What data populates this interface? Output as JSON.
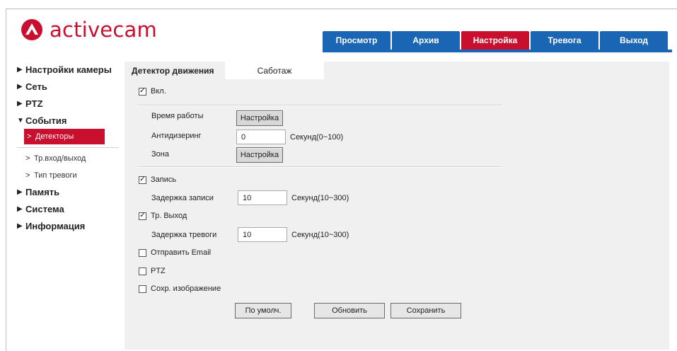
{
  "brand": {
    "name": "activecam",
    "color": "#c8102e"
  },
  "nav": {
    "tabs": [
      {
        "label": "Просмотр",
        "active": false
      },
      {
        "label": "Архив",
        "active": false
      },
      {
        "label": "Настройка",
        "active": true
      },
      {
        "label": "Тревога",
        "active": false
      },
      {
        "label": "Выход",
        "active": false
      }
    ],
    "color": "#1a66b4",
    "active_color": "#c8102e"
  },
  "sidebar": {
    "items": [
      {
        "label": "Настройки камеры"
      },
      {
        "label": "Сеть"
      },
      {
        "label": "PTZ"
      },
      {
        "label": "События",
        "expanded": true,
        "children": [
          {
            "label": "Детекторы",
            "active": true
          },
          {
            "label": "Тр.вход/выход"
          },
          {
            "label": "Тип тревоги"
          }
        ]
      },
      {
        "label": "Память"
      },
      {
        "label": "Система"
      },
      {
        "label": "Информация"
      }
    ]
  },
  "subtabs": [
    {
      "label": "Детектор движения",
      "active": true
    },
    {
      "label": "Саботаж",
      "active": false
    }
  ],
  "form": {
    "enable": {
      "label": "Вкл.",
      "checked": true
    },
    "schedule": {
      "label": "Время работы",
      "button": "Настройка"
    },
    "antidither": {
      "label": "Антидизеринг",
      "value": "0",
      "unit": "Секунд(0~100)"
    },
    "zone": {
      "label": "Зона",
      "button": "Настройка"
    },
    "record": {
      "label": "Запись",
      "checked": true
    },
    "record_delay": {
      "label": "Задержка записи",
      "value": "10",
      "unit": "Секунд(10~300)"
    },
    "alarm_out": {
      "label": "Тр. Выход",
      "checked": true
    },
    "alarm_delay": {
      "label": "Задержка тревоги",
      "value": "10",
      "unit": "Секунд(10~300)"
    },
    "email": {
      "label": "Отправить Email",
      "checked": false
    },
    "ptz": {
      "label": "PTZ",
      "checked": false
    },
    "snapshot": {
      "label": "Сохр. изображение",
      "checked": false
    }
  },
  "actions": {
    "default": "По умолч.",
    "refresh": "Обновить",
    "save": "Сохранить"
  }
}
